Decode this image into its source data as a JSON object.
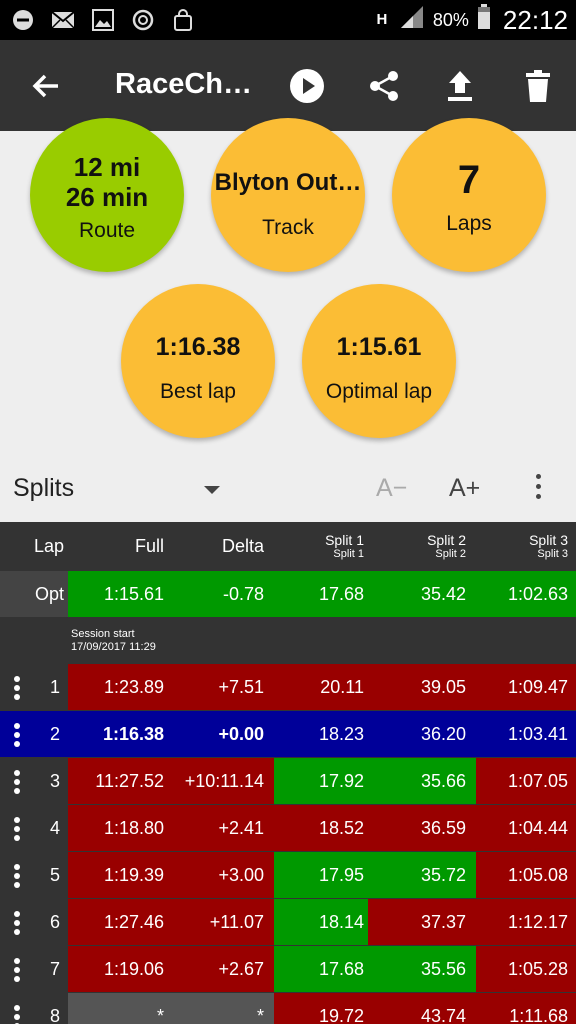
{
  "status_bar": {
    "battery": "80%",
    "time": "22:12",
    "network": "H"
  },
  "app_bar": {
    "title": "RaceCh…"
  },
  "summary": {
    "route_line1": "12 mi",
    "route_line2": "26 min",
    "route_label": "Route",
    "track_value": "Blyton Out…",
    "track_label": "Track",
    "laps_value": "7",
    "laps_label": "Laps",
    "best_value": "1:16.38",
    "best_label": "Best lap",
    "optimal_value": "1:15.61",
    "optimal_label": "Optimal lap"
  },
  "splits_bar": {
    "view_label": "Splits",
    "font_decrease": "A−",
    "font_increase": "A+"
  },
  "table": {
    "headers": {
      "lap": "Lap",
      "full": "Full",
      "delta": "Delta",
      "split1": "Split 1",
      "split1_sub": "Split 1",
      "split2": "Split 2",
      "split2_sub": "Split 2",
      "split3": "Split 3",
      "split3_sub": "Split 3"
    },
    "optimal": {
      "lap": "Opt",
      "full": "1:15.61",
      "delta": "-0.78",
      "split1": "17.68",
      "split2": "35.42",
      "split3": "1:02.63"
    },
    "session": {
      "label": "Session start",
      "date": "17/09/2017 11:29"
    },
    "rows": [
      {
        "lap": "1",
        "full": "1:23.89",
        "delta": "+7.51",
        "split1": "20.11",
        "split2": "39.05",
        "split3": "1:09.47"
      },
      {
        "lap": "2",
        "full": "1:16.38",
        "delta": "+0.00",
        "split1": "18.23",
        "split2": "36.20",
        "split3": "1:03.41"
      },
      {
        "lap": "3",
        "full": "11:27.52",
        "delta": "+10:11.14",
        "split1": "17.92",
        "split2": "35.66",
        "split3": "1:07.05"
      },
      {
        "lap": "4",
        "full": "1:18.80",
        "delta": "+2.41",
        "split1": "18.52",
        "split2": "36.59",
        "split3": "1:04.44"
      },
      {
        "lap": "5",
        "full": "1:19.39",
        "delta": "+3.00",
        "split1": "17.95",
        "split2": "35.72",
        "split3": "1:05.08"
      },
      {
        "lap": "6",
        "full": "1:27.46",
        "delta": "+11.07",
        "split1": "18.14",
        "split2": "37.37",
        "split3": "1:12.17"
      },
      {
        "lap": "7",
        "full": "1:19.06",
        "delta": "+2.67",
        "split1": "17.68",
        "split2": "35.56",
        "split3": "1:05.28"
      },
      {
        "lap": "8",
        "full": "*",
        "delta": "*",
        "split1": "19.72",
        "split2": "43.74",
        "split3": "1:11.68"
      }
    ],
    "colors": {
      "red": "#990000",
      "green": "#009900",
      "blue": "#000099",
      "gray": "#555555",
      "dark": "#333333"
    }
  }
}
